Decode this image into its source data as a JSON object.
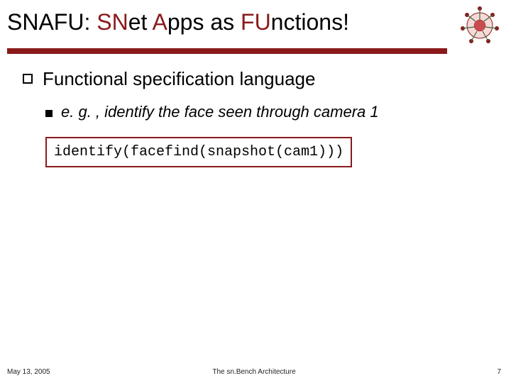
{
  "title": {
    "p1": "SNAFU: ",
    "p2": "SN",
    "p3": "et ",
    "p4": "A",
    "p5": "pps as ",
    "p6": "FU",
    "p7": "nctions!"
  },
  "bullet_main": "Functional specification language",
  "bullet_sub": "e. g. , identify the face seen through camera 1",
  "code": "identify(facefind(snapshot(cam1)))",
  "footer": {
    "date": "May 13, 2005",
    "center": "The sn.Bench Architecture",
    "page": "7"
  },
  "logo_label": "logo-badge"
}
